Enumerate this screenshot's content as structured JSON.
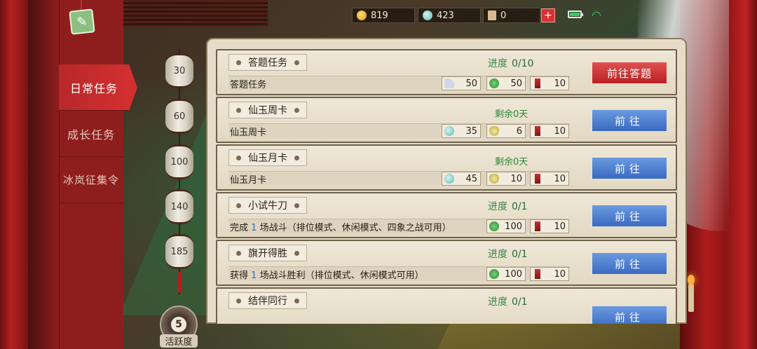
{
  "topbar": {
    "gold": "819",
    "jade": "423",
    "tower": "0",
    "plus_label": "+"
  },
  "sidebar": {
    "tabs": [
      {
        "label": "日常任务",
        "active": true
      },
      {
        "label": "成长任务",
        "active": false
      },
      {
        "label": "冰岚征集令",
        "active": false
      }
    ]
  },
  "activity": {
    "milestones": [
      "30",
      "60",
      "100",
      "140",
      "185"
    ],
    "value": "5",
    "label": "活跃度"
  },
  "tasks": [
    {
      "title": "答题任务",
      "desc": "答题任务",
      "status_label": "进度",
      "status_value": "0/10",
      "rewards": [
        {
          "icon": "boot-icon",
          "value": "50"
        },
        {
          "icon": "exp-icon",
          "value": "50"
        },
        {
          "icon": "red-token-icon",
          "value": "10"
        }
      ],
      "button": "前往答题",
      "button_style": "red"
    },
    {
      "title": "仙玉周卡",
      "desc": "仙玉周卡",
      "remain": "剩余0天",
      "rewards": [
        {
          "icon": "jade-icon",
          "value": "35"
        },
        {
          "icon": "bag-icon",
          "value": "6"
        },
        {
          "icon": "red-token-icon",
          "value": "10"
        }
      ],
      "button": "前往",
      "button_style": "blue"
    },
    {
      "title": "仙玉月卡",
      "desc": "仙玉月卡",
      "remain": "剩余0天",
      "rewards": [
        {
          "icon": "jade-icon",
          "value": "45"
        },
        {
          "icon": "bag-icon",
          "value": "10"
        },
        {
          "icon": "red-token-icon",
          "value": "10"
        }
      ],
      "button": "前往",
      "button_style": "blue"
    },
    {
      "title": "小试牛刀",
      "desc_pre": "完成",
      "desc_num": "1",
      "desc_post": "场战斗（排位模式、休闲模式、四象之战可用）",
      "status_label": "进度",
      "status_value": "0/1",
      "rewards": [
        {
          "icon": "exp-icon",
          "value": "100"
        },
        {
          "icon": "red-token-icon",
          "value": "10"
        }
      ],
      "button": "前往",
      "button_style": "blue"
    },
    {
      "title": "旗开得胜",
      "desc_pre": "获得",
      "desc_num": "1",
      "desc_post": "场战斗胜利（排位模式、休闲模式可用）",
      "status_label": "进度",
      "status_value": "0/1",
      "rewards": [
        {
          "icon": "exp-icon",
          "value": "100"
        },
        {
          "icon": "red-token-icon",
          "value": "10"
        }
      ],
      "button": "前往",
      "button_style": "blue"
    },
    {
      "title": "结伴同行",
      "status_label": "进度",
      "status_value": "0/1",
      "button": "前往",
      "button_style": "blue"
    }
  ]
}
